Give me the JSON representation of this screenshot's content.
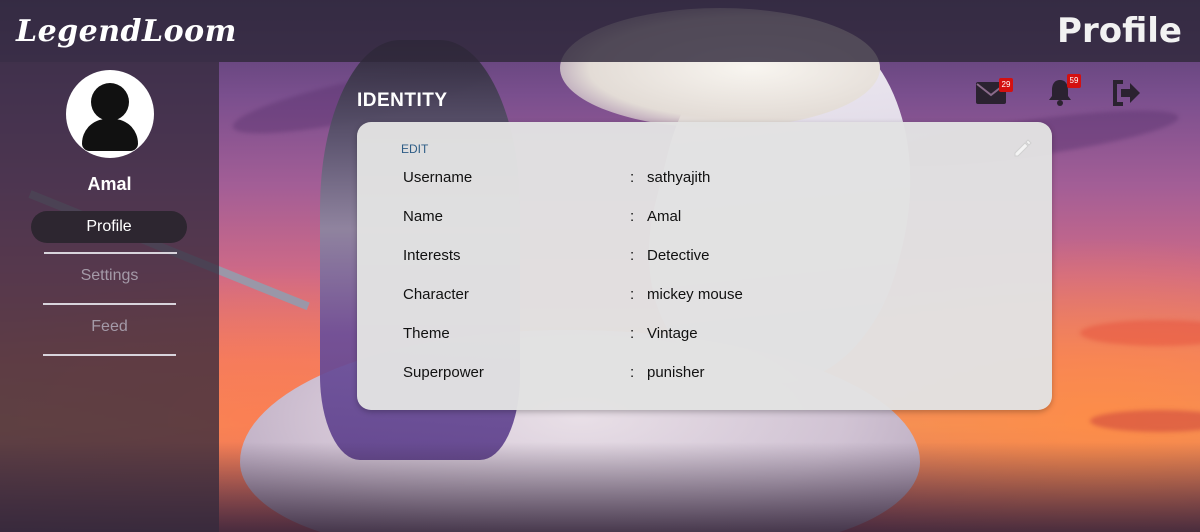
{
  "app": {
    "logo": "LegendLoom",
    "page_title": "Profile"
  },
  "sidebar": {
    "user_name": "Amal",
    "items": [
      {
        "label": "Profile",
        "active": true
      },
      {
        "label": "Settings",
        "active": false
      },
      {
        "label": "Feed",
        "active": false
      }
    ]
  },
  "topbar": {
    "mail_badge": "29",
    "bell_badge": "59",
    "icons": [
      "envelope-icon",
      "bell-icon",
      "logout-icon"
    ]
  },
  "identity": {
    "heading": "IDENTITY",
    "edit_label": "EDIT",
    "separator": ":",
    "rows": [
      {
        "label": "Username",
        "value": "sathyajith"
      },
      {
        "label": "Name",
        "value": "Amal"
      },
      {
        "label": "Interests",
        "value": "Detective"
      },
      {
        "label": "Character",
        "value": "mickey mouse"
      },
      {
        "label": "Theme",
        "value": "Vintage"
      },
      {
        "label": "Superpower",
        "value": "punisher"
      }
    ]
  },
  "colors": {
    "header_bg": "#30283a",
    "card_bg": "#e2e2e2",
    "edit_link": "#2e5d86",
    "badge": "#d41010"
  }
}
